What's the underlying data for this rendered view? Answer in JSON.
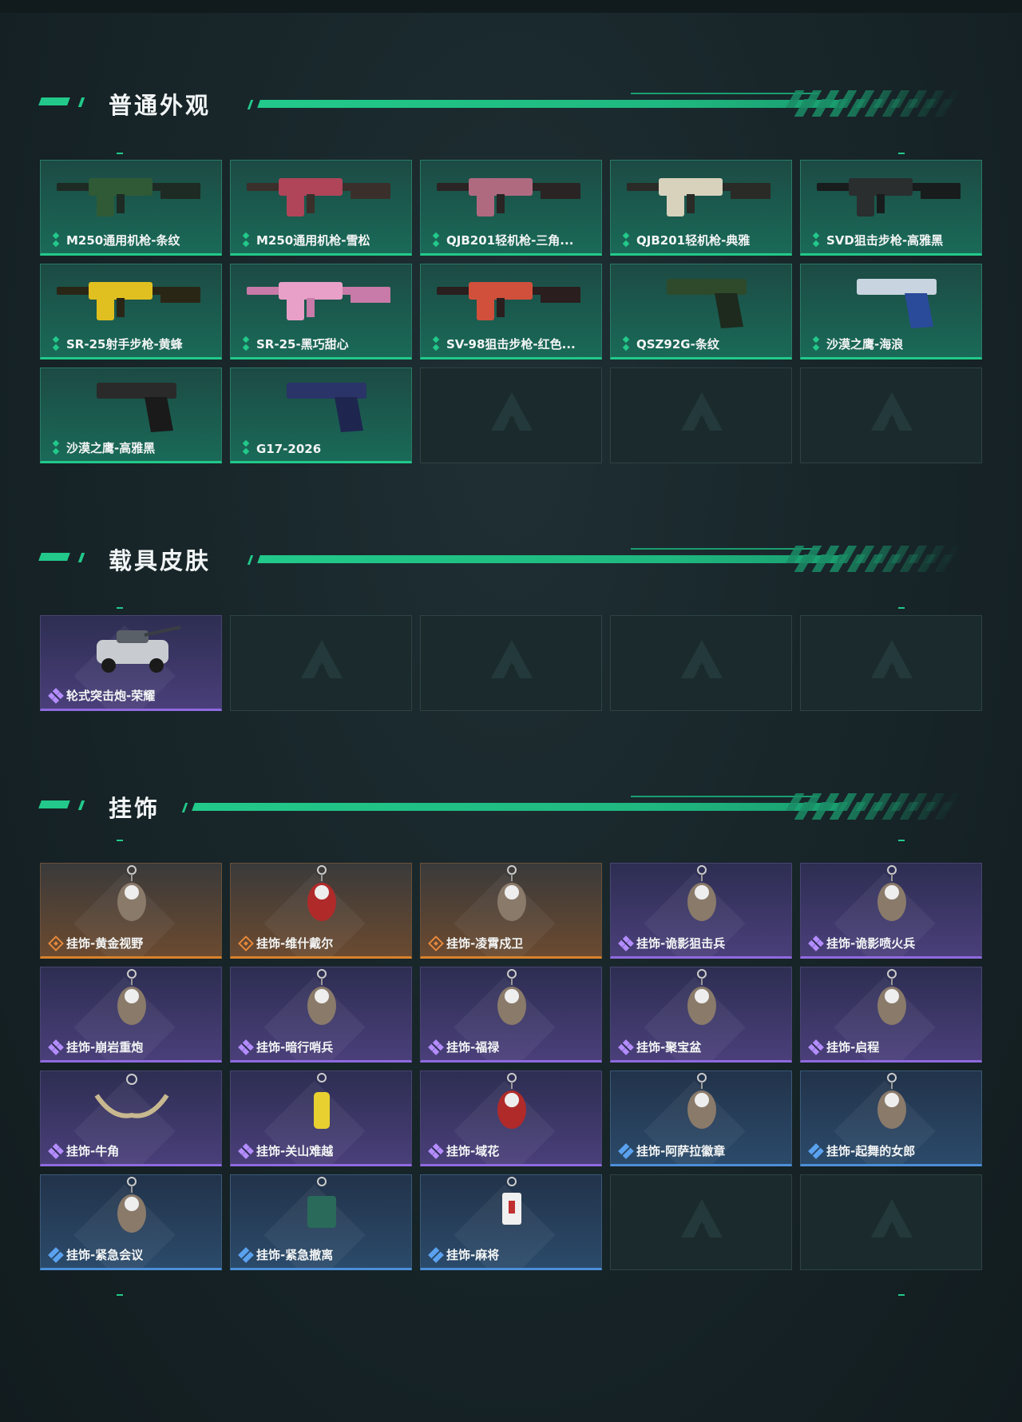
{
  "sections": [
    {
      "title": "普通外观",
      "items": [
        {
          "label": "M250通用机枪-条纹",
          "rarity": "green",
          "art": "machine-gun-green"
        },
        {
          "label": "M250通用机枪-雪松",
          "rarity": "green",
          "art": "machine-gun-red"
        },
        {
          "label": "QJB201轻机枪-三角...",
          "rarity": "green",
          "art": "rifle-pink"
        },
        {
          "label": "QJB201轻机枪-典雅",
          "rarity": "green",
          "art": "rifle-cream"
        },
        {
          "label": "SVD狙击步枪-高雅黑",
          "rarity": "green",
          "art": "sniper-black"
        },
        {
          "label": "SR-25射手步枪-黄蜂",
          "rarity": "green",
          "art": "rifle-yellow"
        },
        {
          "label": "SR-25-黑巧甜心",
          "rarity": "green",
          "art": "rifle-pinkcamo"
        },
        {
          "label": "SV-98狙击步枪-红色...",
          "rarity": "green",
          "art": "sniper-red"
        },
        {
          "label": "QSZ92G-条纹",
          "rarity": "green",
          "art": "pistol-green"
        },
        {
          "label": "沙漠之鹰-海浪",
          "rarity": "green",
          "art": "pistol-blue"
        },
        {
          "label": "沙漠之鹰-高雅黑",
          "rarity": "green",
          "art": "pistol-black"
        },
        {
          "label": "G17-2026",
          "rarity": "green",
          "art": "pistol-navy"
        },
        {
          "label": "",
          "rarity": "empty"
        },
        {
          "label": "",
          "rarity": "empty"
        },
        {
          "label": "",
          "rarity": "empty"
        }
      ]
    },
    {
      "title": "载具皮肤",
      "items": [
        {
          "label": "轮式突击炮-荣耀",
          "rarity": "purple",
          "art": "vehicle"
        },
        {
          "label": "",
          "rarity": "empty"
        },
        {
          "label": "",
          "rarity": "empty"
        },
        {
          "label": "",
          "rarity": "empty"
        },
        {
          "label": "",
          "rarity": "empty"
        }
      ]
    },
    {
      "title": "挂饰",
      "items": [
        {
          "label": "挂饰-黄金视野",
          "rarity": "orange",
          "art": "charm"
        },
        {
          "label": "挂饰-维什戴尔",
          "rarity": "orange",
          "art": "charm-red"
        },
        {
          "label": "挂饰-凌霄戍卫",
          "rarity": "orange",
          "art": "charm"
        },
        {
          "label": "挂饰-诡影狙击兵",
          "rarity": "purple",
          "art": "charm"
        },
        {
          "label": "挂饰-诡影喷火兵",
          "rarity": "purple",
          "art": "charm"
        },
        {
          "label": "挂饰-崩岩重炮",
          "rarity": "purple",
          "art": "charm"
        },
        {
          "label": "挂饰-暗行哨兵",
          "rarity": "purple",
          "art": "charm"
        },
        {
          "label": "挂饰-福禄",
          "rarity": "purple",
          "art": "charm"
        },
        {
          "label": "挂饰-聚宝盆",
          "rarity": "purple",
          "art": "charm"
        },
        {
          "label": "挂饰-启程",
          "rarity": "purple",
          "art": "charm"
        },
        {
          "label": "挂饰-牛角",
          "rarity": "purple",
          "art": "charm-horn"
        },
        {
          "label": "挂饰-关山难越",
          "rarity": "purple",
          "art": "charm-yellow"
        },
        {
          "label": "挂饰-域花",
          "rarity": "purple",
          "art": "charm-red"
        },
        {
          "label": "挂饰-阿萨拉徽章",
          "rarity": "blue",
          "art": "charm"
        },
        {
          "label": "挂饰-起舞的女郎",
          "rarity": "blue",
          "art": "charm"
        },
        {
          "label": "挂饰-紧急会议",
          "rarity": "blue",
          "art": "charm"
        },
        {
          "label": "挂饰-紧急撤离",
          "rarity": "blue",
          "art": "charm-green"
        },
        {
          "label": "挂饰-麻将",
          "rarity": "blue",
          "art": "charm-mahjong"
        },
        {
          "label": "",
          "rarity": "empty"
        },
        {
          "label": "",
          "rarity": "empty"
        }
      ]
    }
  ],
  "colors": {
    "accent_green": "#22c98a",
    "rarity_purple": "#8f6ae0",
    "rarity_orange": "#d9822b",
    "rarity_blue": "#4b8fd8"
  }
}
